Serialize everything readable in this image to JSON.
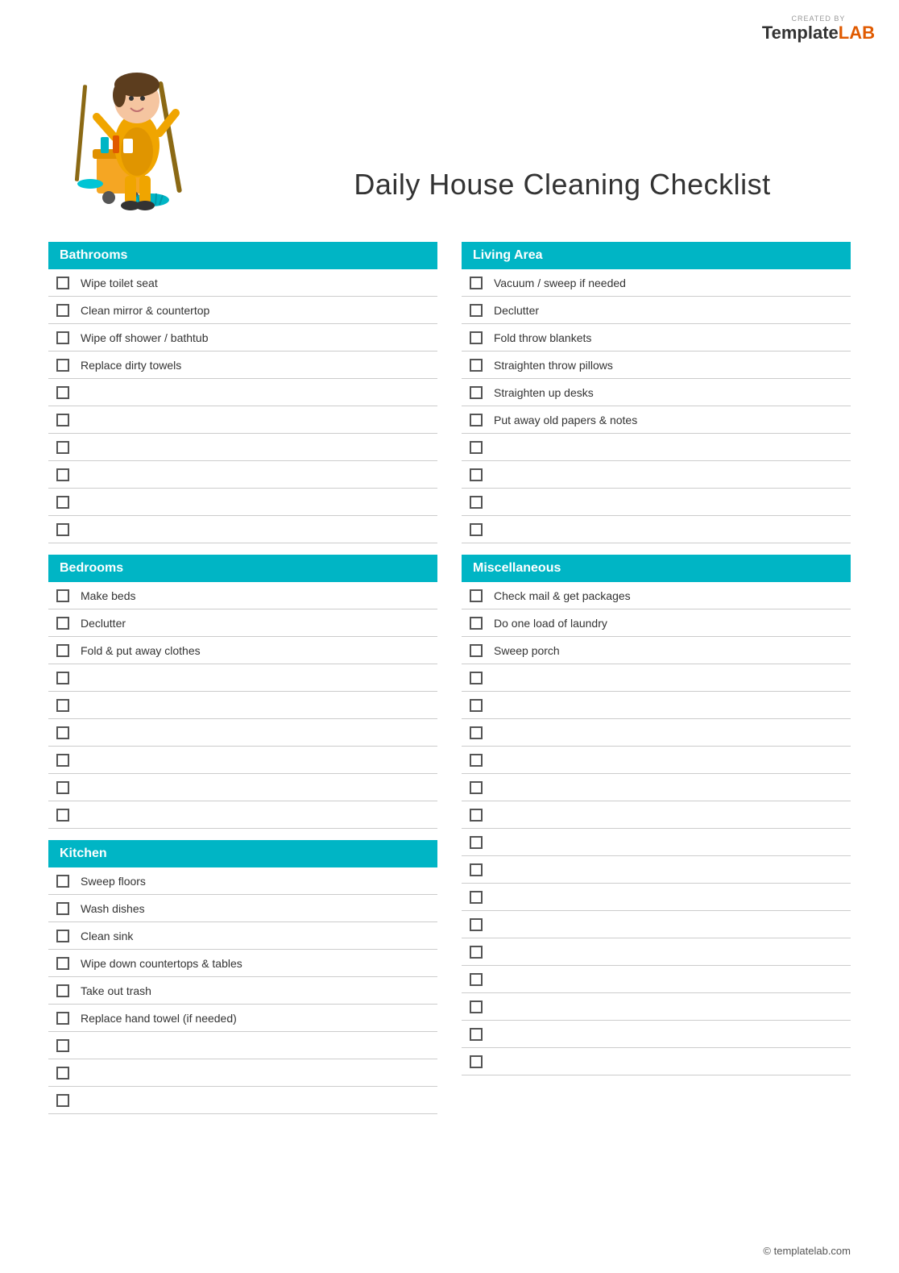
{
  "logo": {
    "created_by": "CREATED BY",
    "template": "Template",
    "lab": "LAB"
  },
  "title": "Daily House Cleaning Checklist",
  "sections": {
    "bathrooms": {
      "label": "Bathrooms",
      "items": [
        "Wipe toilet seat",
        "Clean mirror & countertop",
        "Wipe off shower / bathtub",
        "Replace dirty towels",
        "",
        "",
        "",
        "",
        "",
        ""
      ]
    },
    "bedrooms": {
      "label": "Bedrooms",
      "items": [
        "Make beds",
        "Declutter",
        "Fold & put away clothes",
        "",
        "",
        "",
        "",
        "",
        ""
      ]
    },
    "kitchen": {
      "label": "Kitchen",
      "items": [
        "Sweep floors",
        "Wash dishes",
        "Clean sink",
        "Wipe down countertops & tables",
        "Take out trash",
        "Replace hand towel (if needed)",
        "",
        "",
        ""
      ]
    },
    "living_area": {
      "label": "Living Area",
      "items": [
        "Vacuum / sweep if needed",
        "Declutter",
        "Fold throw blankets",
        "Straighten throw pillows",
        "Straighten up desks",
        "Put away old papers & notes",
        "",
        "",
        "",
        ""
      ]
    },
    "miscellaneous": {
      "label": "Miscellaneous",
      "items": [
        "Check mail & get packages",
        "Do one load of laundry",
        "Sweep porch",
        "",
        "",
        "",
        "",
        "",
        "",
        "",
        "",
        "",
        "",
        ""
      ]
    }
  },
  "footer": {
    "copyright": "© templatelab.com"
  }
}
